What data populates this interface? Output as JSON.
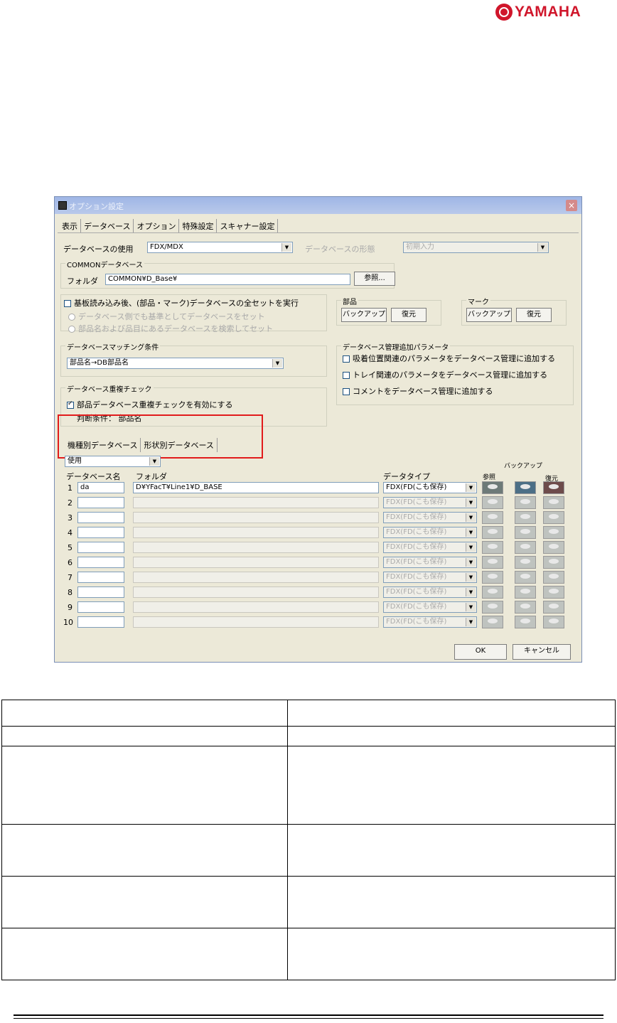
{
  "logo": {
    "text": "YAMAHA",
    "color": "#d0162b"
  },
  "dialog": {
    "title": "オプション設定",
    "close_symbol": "×",
    "tabs": [
      "表示",
      "データベース",
      "オプション",
      "特殊設定",
      "スキャナー設定"
    ],
    "db_usage": {
      "label": "データベースの使用",
      "value": "FDX/MDX",
      "mode_label": "データベースの形態",
      "mode_value": "初期入力"
    },
    "common_db": {
      "group_label": "COMMONデータベース",
      "folder_label": "フォルダ",
      "folder_value": "COMMON¥D_Base¥",
      "browse_label": "参照..."
    },
    "after_read": {
      "checkbox_label": "基板読み込み後、(部品・マーク)データベースの全セットを実行",
      "radio1": "データベース側でも基準としてデータベースをセット",
      "radio2": "部品名および品目にあるデータベースを検索してセット"
    },
    "parts_group": {
      "label": "部品",
      "backup": "バックアップ",
      "restore": "復元"
    },
    "mark_group": {
      "label": "マーク",
      "backup": "バックアップ",
      "restore": "復元"
    },
    "matching": {
      "label": "データベースマッチング条件",
      "value": "部品名→DB部品名"
    },
    "mgmt_params": {
      "label": "データベース管理追加パラメータ",
      "options": [
        "吸着位置関連のパラメータをデータベース管理に追加する",
        "トレイ関連のパラメータをデータベース管理に追加する",
        "コメントをデータベース管理に追加する"
      ]
    },
    "dup_check": {
      "label": "データベース重複チェック",
      "checkbox_label": "部品データベース重複チェックを有効にする",
      "condition": "判断条件： 部品名"
    },
    "db_tabs": [
      "機種別データベース",
      "形状別データベース"
    ],
    "usage_select": "使用",
    "columns": {
      "name": "データベース名",
      "folder": "フォルダ",
      "type": "データタイプ",
      "browse": "参照",
      "backup": "バックアップ",
      "restore": "復元"
    },
    "rows": [
      {
        "num": "1",
        "name": "da",
        "folder": "D¥YFacT¥Line1¥D_BASE",
        "type": "FDX(FD(こも保存)"
      },
      {
        "num": "2",
        "name": "",
        "folder": "",
        "type": "FDX(FD(こも保存)"
      },
      {
        "num": "3",
        "name": "",
        "folder": "",
        "type": "FDX(FD(こも保存)"
      },
      {
        "num": "4",
        "name": "",
        "folder": "",
        "type": "FDX(FD(こも保存)"
      },
      {
        "num": "5",
        "name": "",
        "folder": "",
        "type": "FDX(FD(こも保存)"
      },
      {
        "num": "6",
        "name": "",
        "folder": "",
        "type": "FDX(FD(こも保存)"
      },
      {
        "num": "7",
        "name": "",
        "folder": "",
        "type": "FDX(FD(こも保存)"
      },
      {
        "num": "8",
        "name": "",
        "folder": "",
        "type": "FDX(FD(こも保存)"
      },
      {
        "num": "9",
        "name": "",
        "folder": "",
        "type": "FDX(FD(こも保存)"
      },
      {
        "num": "10",
        "name": "",
        "folder": "",
        "type": "FDX(FD(こも保存)"
      }
    ],
    "ok_label": "OK",
    "cancel_label": "キャンセル"
  }
}
